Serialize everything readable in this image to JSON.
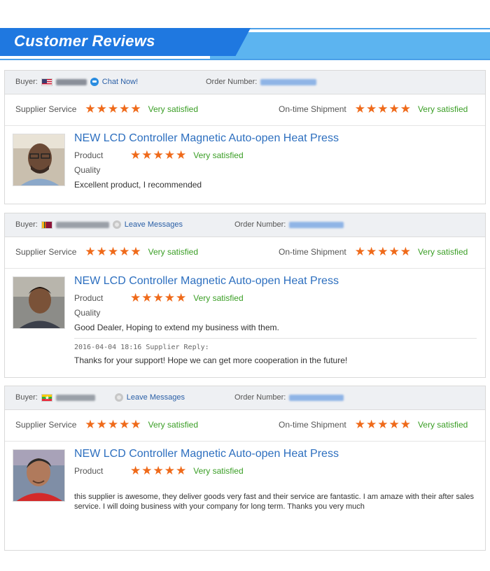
{
  "header": {
    "title": "Customer Reviews"
  },
  "labels": {
    "buyer": "Buyer:",
    "order_number": "Order Number:",
    "supplier_service": "Supplier Service",
    "ontime_shipment": "On-time Shipment",
    "product": "Product",
    "quality": "Quality",
    "very_satisfied": "Very satisfied",
    "star": "★"
  },
  "colors": {
    "banner_dark": "#1f78e0",
    "banner_light": "#5cb4f0",
    "star": "#ef6a1a",
    "satisfied": "#3a9e25",
    "link": "#2a5fa6"
  },
  "reviews": [
    {
      "buyer_flag": "flag-usa-icon",
      "action": "Chat Now!",
      "product_title": "NEW LCD Controller Magnetic Auto-open Heat Press",
      "comment": "Excellent product, I recommended",
      "supplier_rating": 5,
      "shipment_rating": 5,
      "product_rating": 5
    },
    {
      "buyer_flag": "flag-sri-lanka-icon",
      "action": "Leave Messages",
      "product_title": "NEW LCD Controller Magnetic Auto-open Heat Press",
      "comment": "Good Dealer, Hoping to extend my business with them.",
      "reply_meta": "2016-04-04 18:16  Supplier Reply:",
      "reply_text": "Thanks for your support! Hope we can get more cooperation in the future!",
      "supplier_rating": 5,
      "shipment_rating": 5,
      "product_rating": 5
    },
    {
      "buyer_flag": "flag-myanmar-icon",
      "action": "Leave Messages",
      "product_title": "NEW LCD Controller Magnetic Auto-open Heat Press",
      "comment": "this supplier is awesome, they deliver goods very fast and their service are fantastic. I am amaze with their after sales service. I will doing business with your company for long term.  Thanks you very much",
      "supplier_rating": 5,
      "shipment_rating": 5,
      "product_rating": 5
    }
  ]
}
